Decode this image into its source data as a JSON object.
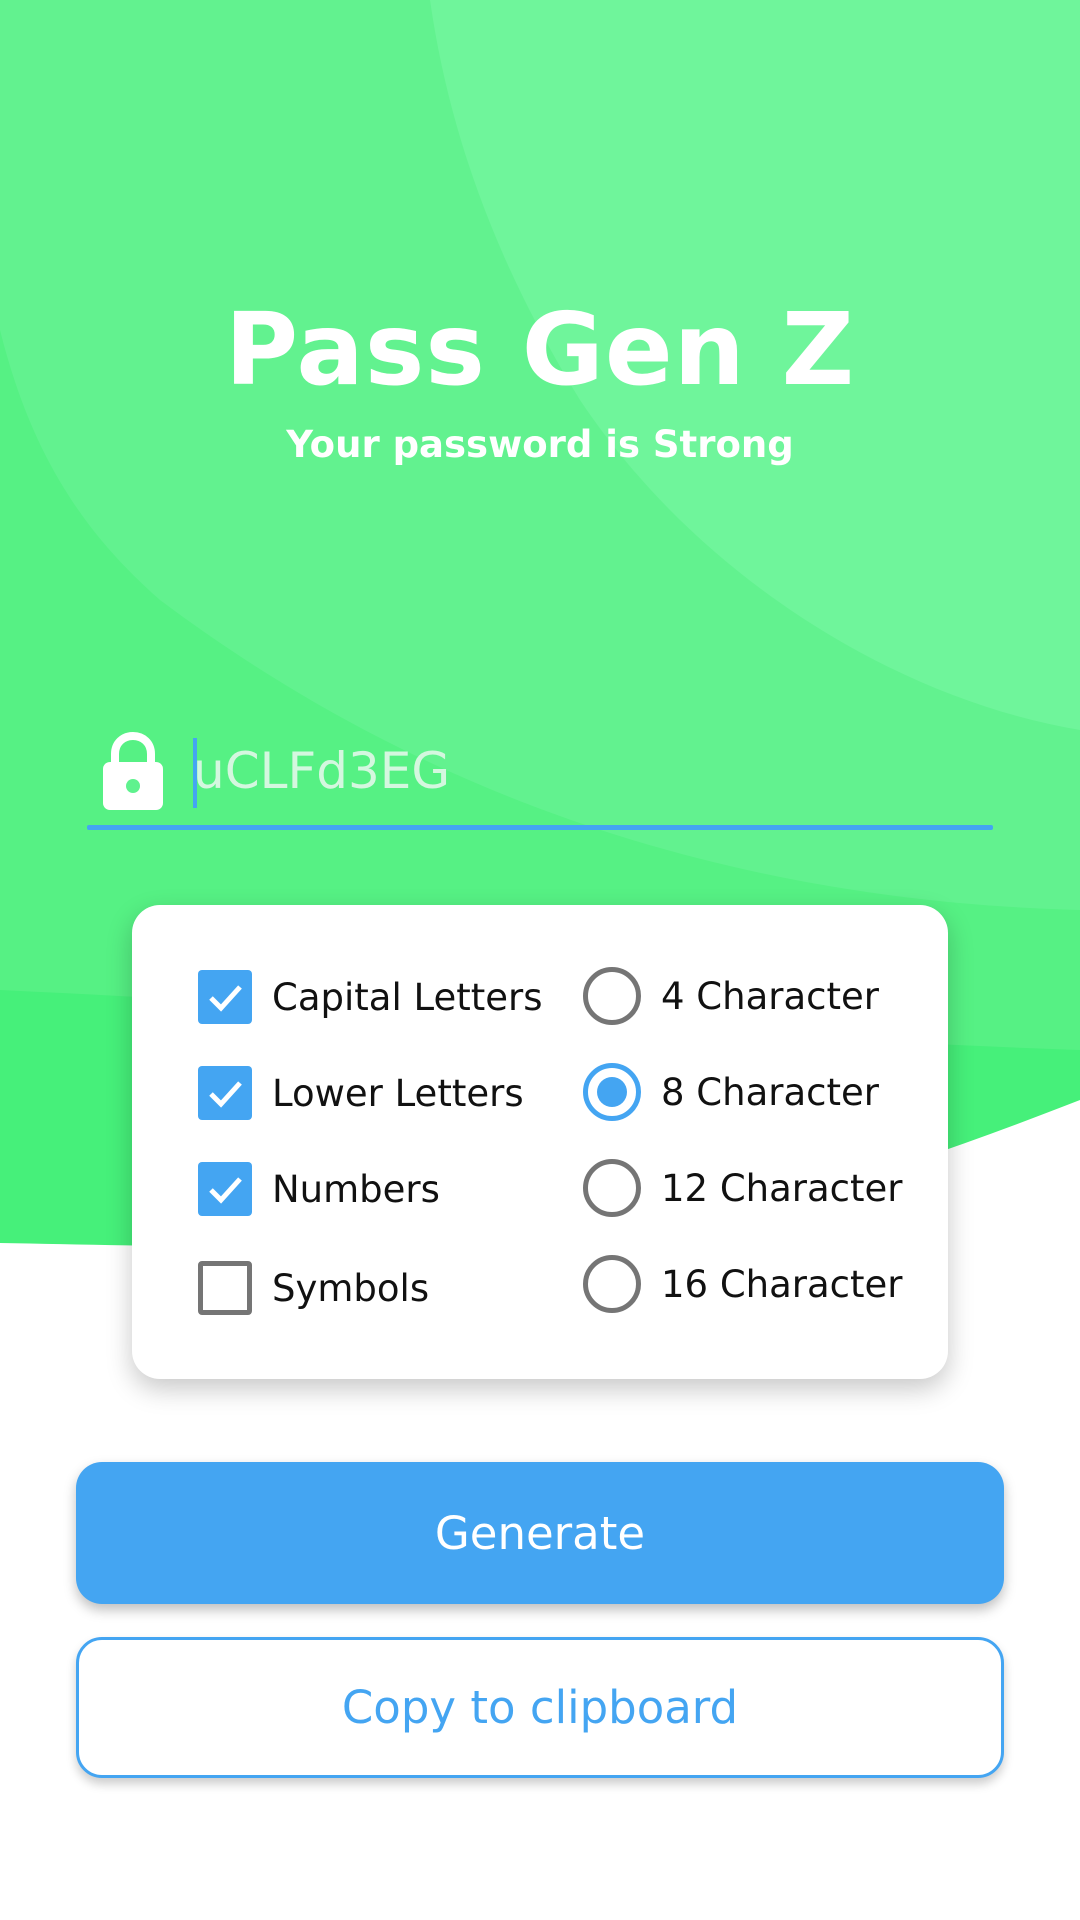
{
  "app": {
    "title": "Pass Gen Z",
    "subtitle": "Your password is Strong"
  },
  "password": {
    "value": "uCLFd3EG",
    "icon": "lock-icon"
  },
  "options": {
    "characters": [
      {
        "label": "Capital Letters",
        "checked": true
      },
      {
        "label": "Lower Letters",
        "checked": true
      },
      {
        "label": "Numbers",
        "checked": true
      },
      {
        "label": "Symbols",
        "checked": false
      }
    ],
    "lengths": [
      {
        "label": "4 Character",
        "selected": false
      },
      {
        "label": "8 Character",
        "selected": true
      },
      {
        "label": "12 Character",
        "selected": false
      },
      {
        "label": "16 Character",
        "selected": false
      }
    ]
  },
  "buttons": {
    "generate": "Generate",
    "copy": "Copy to clipboard"
  },
  "colors": {
    "accent": "#44a5f2",
    "green_dark": "#46f07a",
    "green_mid": "#5ff28e",
    "green_light": "#72f598",
    "text": "#111111",
    "unchecked": "#757575"
  }
}
